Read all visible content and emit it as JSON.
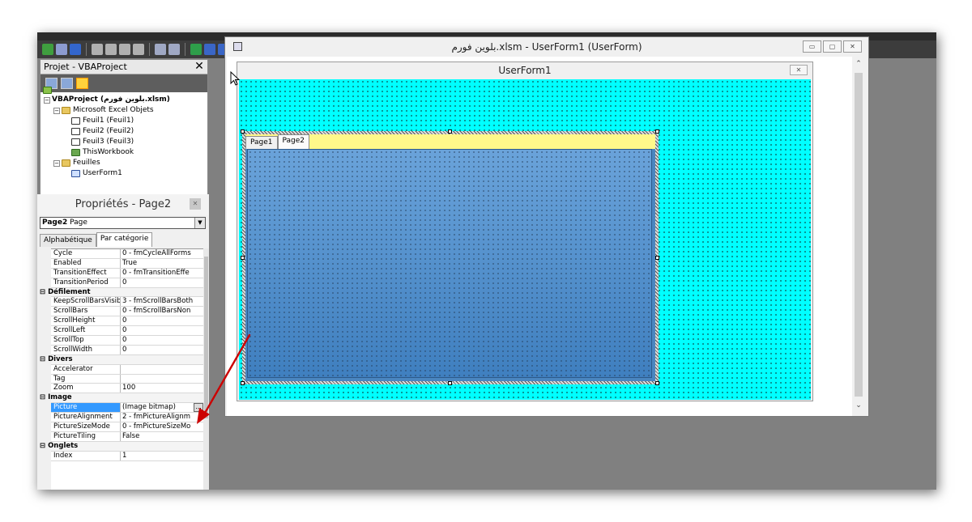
{
  "toolbar": {
    "search_value": ""
  },
  "project": {
    "title": "Projet - VBAProject",
    "close": "✕",
    "tree": [
      {
        "label": "VBAProject (بلوين فورم.xlsm)",
        "bold": true
      },
      {
        "label": "Microsoft Excel Objets"
      },
      {
        "label": "Feuil1 (Feuil1)"
      },
      {
        "label": "Feuil2 (Feuil2)"
      },
      {
        "label": "Feuil3 (Feuil3)"
      },
      {
        "label": "ThisWorkbook"
      },
      {
        "label": "Feuilles"
      },
      {
        "label": "UserForm1"
      }
    ]
  },
  "properties": {
    "title": "Propriétés - Page2",
    "object_name": "Page2",
    "object_type": "Page",
    "tabs": [
      "Alphabétique",
      "Par catégorie"
    ],
    "rows": [
      {
        "k": "Cycle",
        "v": "0 - fmCycleAllForms"
      },
      {
        "k": "Enabled",
        "v": "True"
      },
      {
        "k": "TransitionEffect",
        "v": "0 - fmTransitionEffe"
      },
      {
        "k": "TransitionPeriod",
        "v": "0"
      },
      {
        "cat": "Défilement"
      },
      {
        "k": "KeepScrollBarsVisible",
        "v": "3 - fmScrollBarsBoth"
      },
      {
        "k": "ScrollBars",
        "v": "0 - fmScrollBarsNon"
      },
      {
        "k": "ScrollHeight",
        "v": "0"
      },
      {
        "k": "ScrollLeft",
        "v": "0"
      },
      {
        "k": "ScrollTop",
        "v": "0"
      },
      {
        "k": "ScrollWidth",
        "v": "0"
      },
      {
        "cat": "Divers"
      },
      {
        "k": "Accelerator",
        "v": ""
      },
      {
        "k": "Tag",
        "v": ""
      },
      {
        "k": "Zoom",
        "v": "100"
      },
      {
        "cat": "Image"
      },
      {
        "k": "Picture",
        "v": "(Image bitmap)",
        "selected": true
      },
      {
        "k": "PictureAlignment",
        "v": "2 - fmPictureAlignm"
      },
      {
        "k": "PictureSizeMode",
        "v": "0 - fmPictureSizeMo"
      },
      {
        "k": "PictureTiling",
        "v": "False"
      },
      {
        "cat": "Onglets"
      },
      {
        "k": "Index",
        "v": "1"
      }
    ],
    "ellipsis": "..."
  },
  "designer": {
    "title": "بلوين فورم.xlsm - UserForm1 (UserForm)",
    "userform_title": "UserForm1",
    "tabs": [
      "Page1",
      "Page2"
    ]
  },
  "colors": {
    "form_bg": "#00ffff",
    "tabstrip_bg": "#fff88a",
    "page_bg": "#4a86c0",
    "arrow": "#cc0000"
  }
}
